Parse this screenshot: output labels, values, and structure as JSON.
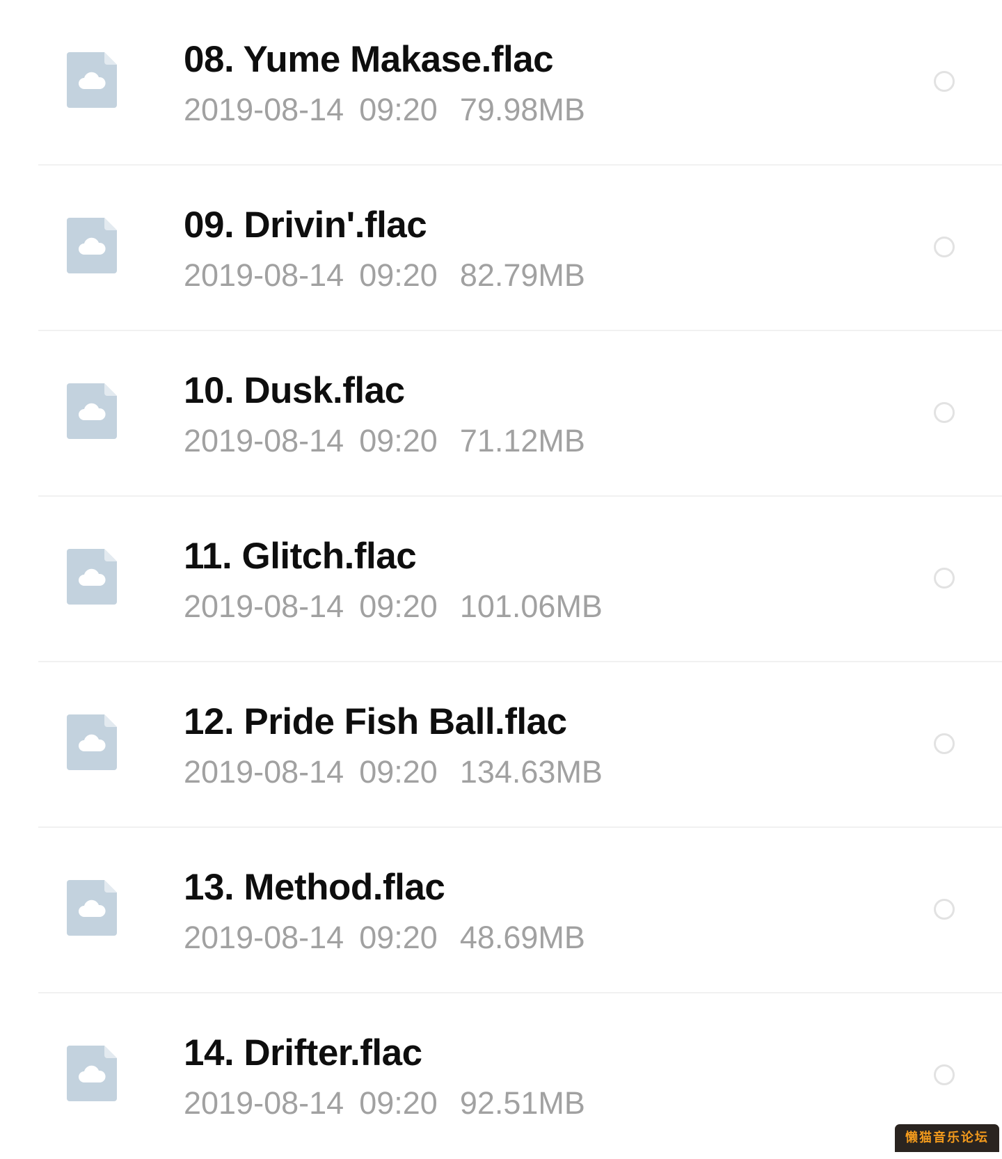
{
  "files": [
    {
      "name": "08. Yume Makase.flac",
      "date": "2019-08-14",
      "time": "09:20",
      "size": "79.98MB",
      "icon": "cloud-file-icon",
      "selected": false
    },
    {
      "name": "09. Drivin'.flac",
      "date": "2019-08-14",
      "time": "09:20",
      "size": "82.79MB",
      "icon": "cloud-file-icon",
      "selected": false
    },
    {
      "name": "10. Dusk.flac",
      "date": "2019-08-14",
      "time": "09:20",
      "size": "71.12MB",
      "icon": "cloud-file-icon",
      "selected": false
    },
    {
      "name": "11. Glitch.flac",
      "date": "2019-08-14",
      "time": "09:20",
      "size": "101.06MB",
      "icon": "cloud-file-icon",
      "selected": false
    },
    {
      "name": "12. Pride Fish Ball.flac",
      "date": "2019-08-14",
      "time": "09:20",
      "size": "134.63MB",
      "icon": "cloud-file-icon",
      "selected": false
    },
    {
      "name": "13. Method.flac",
      "date": "2019-08-14",
      "time": "09:20",
      "size": "48.69MB",
      "icon": "cloud-file-icon",
      "selected": false
    },
    {
      "name": "14. Drifter.flac",
      "date": "2019-08-14",
      "time": "09:20",
      "size": "92.51MB",
      "icon": "cloud-file-icon",
      "selected": false
    }
  ],
  "watermark": {
    "text": "懒猫音乐论坛"
  },
  "colors": {
    "file_name": "#0e0e0e",
    "meta": "#a1a1a1",
    "icon": "#c3d2de",
    "divider": "#f1f1f1",
    "select_circle": "#e2e2e2",
    "watermark_bg": "#2a2420",
    "watermark_text": "#f39a1c"
  }
}
